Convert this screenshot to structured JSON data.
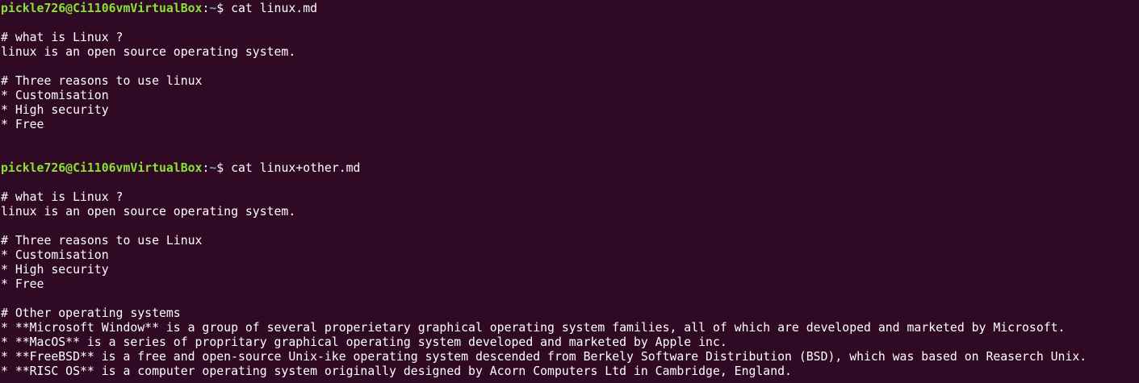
{
  "terminal": {
    "prompt_user_host": "pickle726@Ci1106vmVirtualBox",
    "prompt_sep": ":",
    "prompt_path": "~",
    "prompt_symbol": "$ ",
    "colors": {
      "background": "#300a24",
      "text": "#ffffff",
      "prompt_user": "#8ae234",
      "prompt_path": "#729fcf"
    },
    "command1": "cat linux.md",
    "output1": [
      "",
      "# what is Linux ?",
      "linux is an open source operating system.",
      "",
      "# Three reasons to use linux",
      "* Customisation",
      "* High security",
      "* Free",
      "",
      ""
    ],
    "command2": "cat linux+other.md",
    "output2": [
      "",
      "# what is Linux ?",
      "linux is an open source operating system.",
      "",
      "# Three reasons to use Linux",
      "* Customisation",
      "* High security",
      "* Free",
      "",
      "# Other operating systems",
      "* **Microsoft Window** is a group of several properietary graphical operating system families, all of which are developed and marketed by Microsoft.",
      "* **MacOS** is a series of propritary graphical operating system developed and marketed by Apple inc.",
      "* **FreeBSD** is a free and open-source Unix-ike operating system descended from Berkely Software Distribution (BSD), which was based on Reaserch Unix.",
      "* **RISC OS** is a computer operating system originally designed by Acorn Computers Ltd in Cambridge, England."
    ]
  }
}
